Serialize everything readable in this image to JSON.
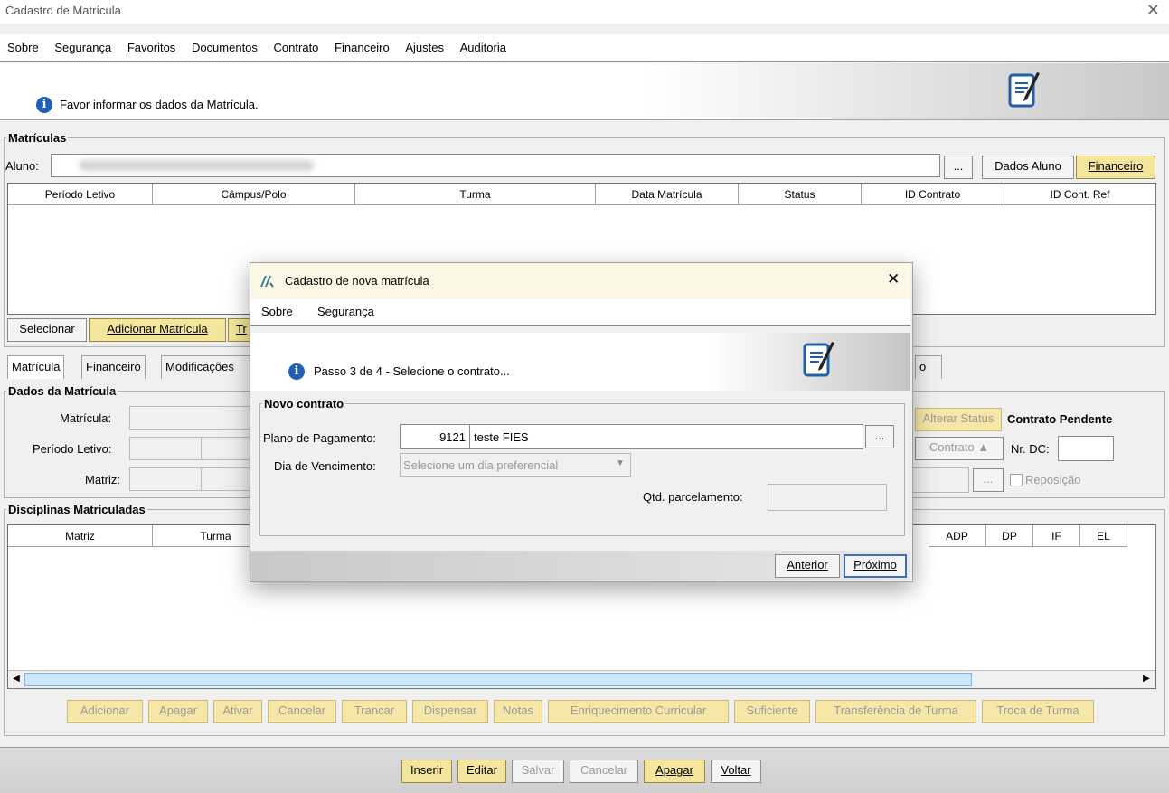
{
  "window": {
    "title": "Cadastro de Matrícula",
    "close_glyph": "✕"
  },
  "menu": [
    "Sobre",
    "Segurança",
    "Favoritos",
    "Documentos",
    "Contrato",
    "Financeiro",
    "Ajustes",
    "Auditoria"
  ],
  "header": {
    "message": "Favor informar os dados da Matrícula.",
    "icon": "info-icon"
  },
  "matriculas": {
    "legend": "Matrículas",
    "aluno_label": "Aluno:",
    "browse_label": "...",
    "dados_aluno_label": "Dados Aluno",
    "financeiro_label": "Financeiro",
    "columns": [
      "Período Letivo",
      "Câmpus/Polo",
      "Turma",
      "Data Matrícula",
      "Status",
      "ID Contrato",
      "ID Cont. Ref"
    ],
    "buttons": {
      "selecionar": "Selecionar",
      "adicionar": "Adicionar Matrícula",
      "partial": "Tr"
    }
  },
  "tabs": [
    "Matrícula",
    "Financeiro",
    "Modificações",
    "o"
  ],
  "dados": {
    "legend": "Dados da Matrícula",
    "matricula_label": "Matrícula:",
    "periodo_label": "Período Letivo:",
    "matriz_label": "Matriz:",
    "alterar_status": "Alterar Status",
    "contrato_pendente": "Contrato Pendente",
    "contrato_btn": "Contrato ▲",
    "nr_dc_label": "Nr. DC:",
    "browse_label": "...",
    "reposicao_label": "Reposição"
  },
  "disciplinas": {
    "legend": "Disciplinas Matriculadas",
    "columns_left": [
      "Matriz",
      "Turma"
    ],
    "columns_right": [
      "ADP",
      "DP",
      "IF",
      "EL"
    ],
    "buttons": [
      "Adicionar",
      "Apagar",
      "Ativar",
      "Cancelar",
      "Trancar",
      "Dispensar",
      "Notas",
      "Enriquecimento Curricular",
      "Suficiente",
      "Transferência de Turma",
      "Troca de Turma"
    ]
  },
  "bottom_buttons": {
    "inserir": "Inserir",
    "editar": "Editar",
    "salvar": "Salvar",
    "cancelar": "Cancelar",
    "apagar": "Apagar",
    "voltar": "Voltar"
  },
  "modal": {
    "title": "Cadastro de nova matrícula",
    "close_glyph": "✕",
    "menu": [
      "Sobre",
      "Segurança"
    ],
    "step_message": "Passo 3 de 4 - Selecione o contrato...",
    "legend": "Novo contrato",
    "plano_label": "Plano de Pagamento:",
    "plano_code": "9121",
    "plano_name": "teste FIES",
    "browse_label": "...",
    "dia_label": "Dia de Vencimento:",
    "dia_placeholder": "Selecione um dia preferencial",
    "qtd_label": "Qtd. parcelamento:",
    "qtd_value": "",
    "anterior": "Anterior",
    "proximo": "Próximo"
  }
}
